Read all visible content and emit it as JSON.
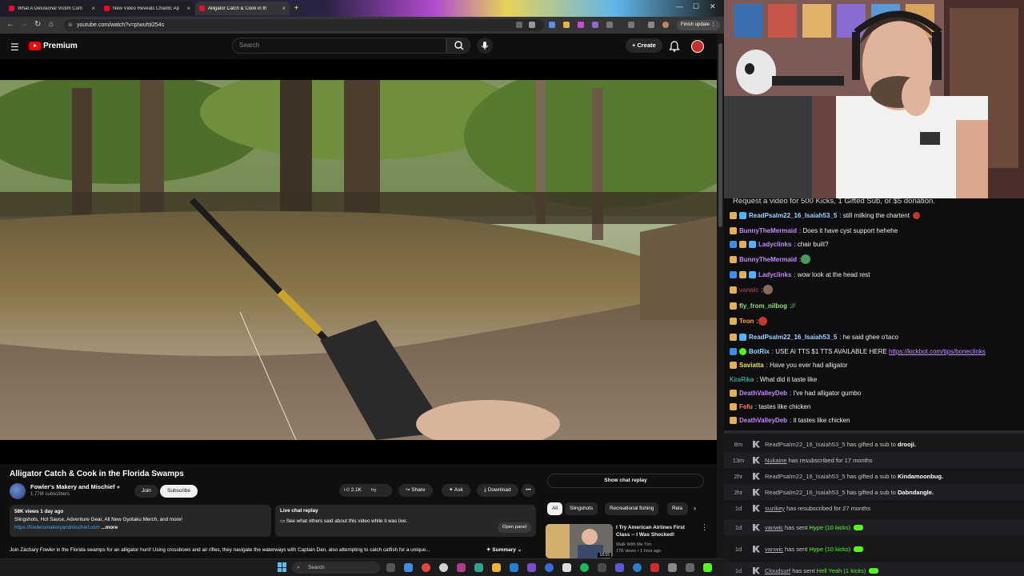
{
  "browser": {
    "tabs": [
      {
        "title": "What A Delusional Victim Com",
        "active": false
      },
      {
        "title": "New Video Reveals Chaotic Ap",
        "active": false
      },
      {
        "title": "Alligator Catch & Cook in th",
        "active": true
      }
    ],
    "url": "youtube.com/watch?v=pIwuhti254s",
    "finish_update": "Finish update"
  },
  "youtube": {
    "logo_text": "Premium",
    "search_placeholder": "Search",
    "create_label": "Create",
    "video_title": "Alligator Catch & Cook in the Florida Swamps",
    "channel": {
      "name": "Fowler's Makery and Mischief",
      "subs": "1.77M subscribers"
    },
    "join_label": "Join",
    "subscribe_label": "Subscribe",
    "likes": "2.1K",
    "share_label": "Share",
    "ask_label": "Ask",
    "download_label": "Download",
    "description": {
      "stats": "58K views  1 day ago",
      "line1": "Slingshots, Hot Sauce, Adventure Gear,  All New Gyotaku Merch, and more!",
      "link": "https://fowlersmakeryandmischief.com",
      "more": "...more"
    },
    "live_chat_replay": {
      "title": "Live chat replay",
      "text": "See what others said about this video while it was live.",
      "open_panel": "Open panel"
    },
    "full_description": "Join Zachary Fowler in the Florida swamps for an alligator hunt! Using crossbows and air rifles, they navigate the waterways with Captain Dan, also attempting to catch catfish for a unique...",
    "summary_label": "Summary",
    "show_chat_replay": "Show chat replay",
    "chips": [
      "All",
      "Slingshots",
      "Recreational fishing",
      "Rela"
    ],
    "recommendation": {
      "title": "I Try American Airlines First Class -- I Was Shocked!",
      "channel": "Walk With Me Tim",
      "meta": "17K views • 1 hour ago",
      "duration": "18:55"
    }
  },
  "taskbar": {
    "search_placeholder": "Search"
  },
  "chat": {
    "banner": "Request a video for 500 Kicks, 1 Gifted Sub, or $5 donation.",
    "messages": [
      {
        "user": "ReadPsalm22_16_Isaiah53_5",
        "text": "still milking the chartent",
        "color": "#9ad7ff"
      },
      {
        "user": "BunnyTheMermaid",
        "text": "Does it have cyst support hehehe",
        "color": "#c58af9"
      },
      {
        "user": "Ladyclinks",
        "text": "chair built?",
        "color": "#c58af9"
      },
      {
        "user": "BunnyTheMermaid",
        "text": "",
        "color": "#c58af9"
      },
      {
        "user": "Ladyclinks",
        "text": "wow look at the head rest",
        "color": "#c58af9"
      },
      {
        "user": "vanwic",
        "text": "",
        "color": "#e0334c"
      },
      {
        "user": "fly_from_nilbog",
        "text": "",
        "color": "#8fe36c"
      },
      {
        "user": "Teon",
        "text": "",
        "color": "#f5a623"
      },
      {
        "user": "ReadPsalm22_16_Isaiah53_5",
        "text": "he said ghee o'taco",
        "color": "#9ad7ff"
      },
      {
        "user": "BotRix",
        "text": "USE AI TTS $1 TTS AVAILABLE HERE",
        "link": "https://kickbot.com/tips/boneclinks",
        "color": "#9ad7ff"
      },
      {
        "user": "Saviatta",
        "text": "Have you ever had alligator",
        "color": "#e6e65c"
      },
      {
        "user": "KiraRika",
        "text": "What did it taste like",
        "color": "#4fd1c5"
      },
      {
        "user": "DeathValleyDeb",
        "text": "I've had alligator gumbo",
        "color": "#c58af9"
      },
      {
        "user": "Fefu",
        "text": "tastes like chicken",
        "color": "#ff7c5c"
      },
      {
        "user": "DeathValleyDeb",
        "text": "it tastes like chicken",
        "color": "#c58af9"
      }
    ]
  },
  "events": [
    {
      "time": "8m",
      "name": "ReadPsalm22_16_Isaiah53_5",
      "text": "has gifted a sub to",
      "target": "drooji."
    },
    {
      "time": "13m",
      "name": "Nukaine",
      "text": "has resubscribed for 17 months",
      "target": ""
    },
    {
      "time": "2hr",
      "name": "ReadPsalm22_16_Isaiah53_5",
      "text": "has gifted a sub to",
      "target": "Kindamoonbug."
    },
    {
      "time": "2hr",
      "name": "ReadPsalm22_16_Isaiah53_5",
      "text": "has gifted a sub to",
      "target": "Dabndangle."
    },
    {
      "time": "1d",
      "name": "suzikey",
      "text": "has resubscribed for 27 months",
      "target": ""
    },
    {
      "time": "1d",
      "name": "vanwic",
      "text": "has sent",
      "target": "Hype (10 kicks)"
    },
    {
      "time": "1d",
      "name": "vanwic",
      "text": "has sent",
      "target": "Hype (10 kicks)"
    },
    {
      "time": "1d",
      "name": "Cloudsurf",
      "text": "has sent",
      "target": "Hell Yeah (1 kicks)"
    }
  ]
}
